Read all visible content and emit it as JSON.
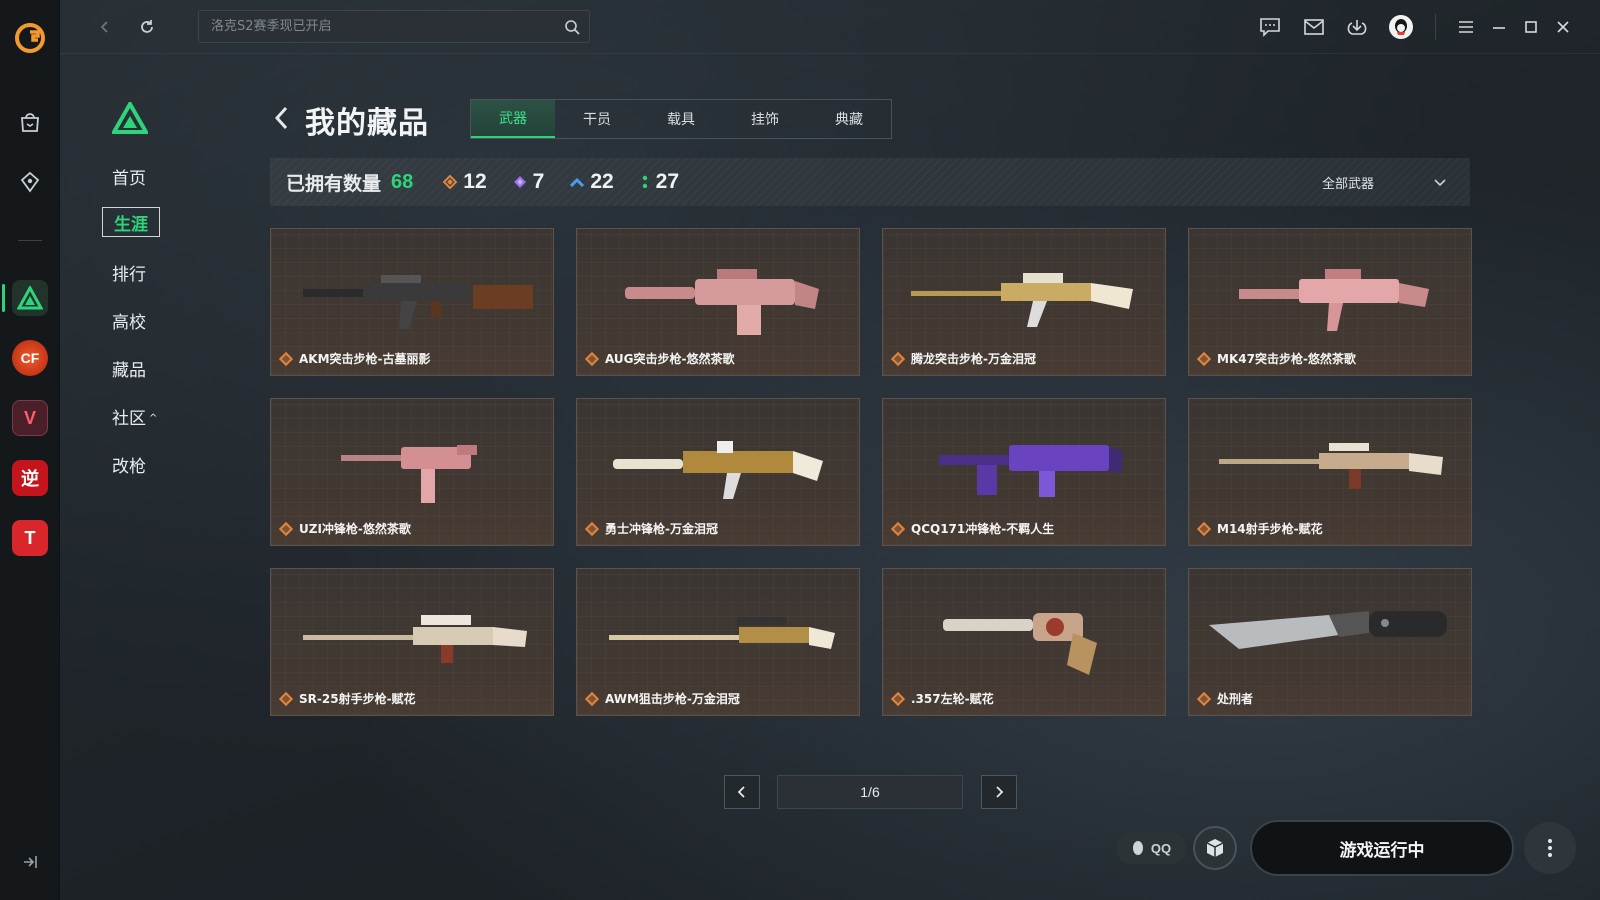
{
  "search": {
    "placeholder": "洛克S2赛季现已开启"
  },
  "sidebar": {
    "items": [
      {
        "label": "首页"
      },
      {
        "label": "生涯"
      },
      {
        "label": "排行"
      },
      {
        "label": "高校"
      },
      {
        "label": "藏品"
      },
      {
        "label": "社区"
      },
      {
        "label": "改枪"
      }
    ],
    "active_index": 1
  },
  "rail_games": [
    {
      "icon": "game-triangle-icon",
      "text": ""
    },
    {
      "icon": "cf-icon",
      "text": "CF"
    },
    {
      "icon": "valorant-icon",
      "text": "V"
    },
    {
      "icon": "ni-icon",
      "text": "逆"
    },
    {
      "icon": "t-icon",
      "text": "T"
    }
  ],
  "header": {
    "title": "我的藏品",
    "tabs": [
      {
        "label": "武器"
      },
      {
        "label": "干员"
      },
      {
        "label": "载具"
      },
      {
        "label": "挂饰"
      },
      {
        "label": "典藏"
      }
    ],
    "active_tab": 0
  },
  "stats": {
    "owned_label": "已拥有数量",
    "owned_count": "68",
    "rarities": [
      {
        "icon": "orange-diamond-icon",
        "color": "#e2843c",
        "count": "12"
      },
      {
        "icon": "purple-diamond-icon",
        "color": "#9a6cf0",
        "count": "7"
      },
      {
        "icon": "blue-chevron-icon",
        "color": "#4a9bf0",
        "count": "22"
      },
      {
        "icon": "green-dots-icon",
        "color": "#2ed47a",
        "count": "27"
      }
    ],
    "filter_label": "全部武器"
  },
  "items": [
    {
      "name": "AKM突击步枪-古墓丽影",
      "finish": "brown"
    },
    {
      "name": "AUG突击步枪-悠然茶歌",
      "finish": "pink"
    },
    {
      "name": "腾龙突击步枪-万金泪冠",
      "finish": "gold"
    },
    {
      "name": "MK47突击步枪-悠然茶歌",
      "finish": "pink"
    },
    {
      "name": "UZI冲锋枪-悠然茶歌",
      "finish": "pink"
    },
    {
      "name": "勇士冲锋枪-万金泪冠",
      "finish": "gold"
    },
    {
      "name": "QCQ171冲锋枪-不羁人生",
      "finish": "purple"
    },
    {
      "name": "M14射手步枪-赋花",
      "finish": "tan"
    },
    {
      "name": "SR-25射手步枪-赋花",
      "finish": "tan"
    },
    {
      "name": "AWM狙击步枪-万金泪冠",
      "finish": "gold"
    },
    {
      "name": ".357左轮-赋花",
      "finish": "tan"
    },
    {
      "name": "处刑者",
      "finish": "knife"
    }
  ],
  "pagination": {
    "text": "1/6"
  },
  "bottom": {
    "qq_label": "QQ",
    "run_label": "游戏运行中"
  },
  "colors": {
    "accent": "#2ed47a",
    "rarity_orange": "#e2843c"
  }
}
